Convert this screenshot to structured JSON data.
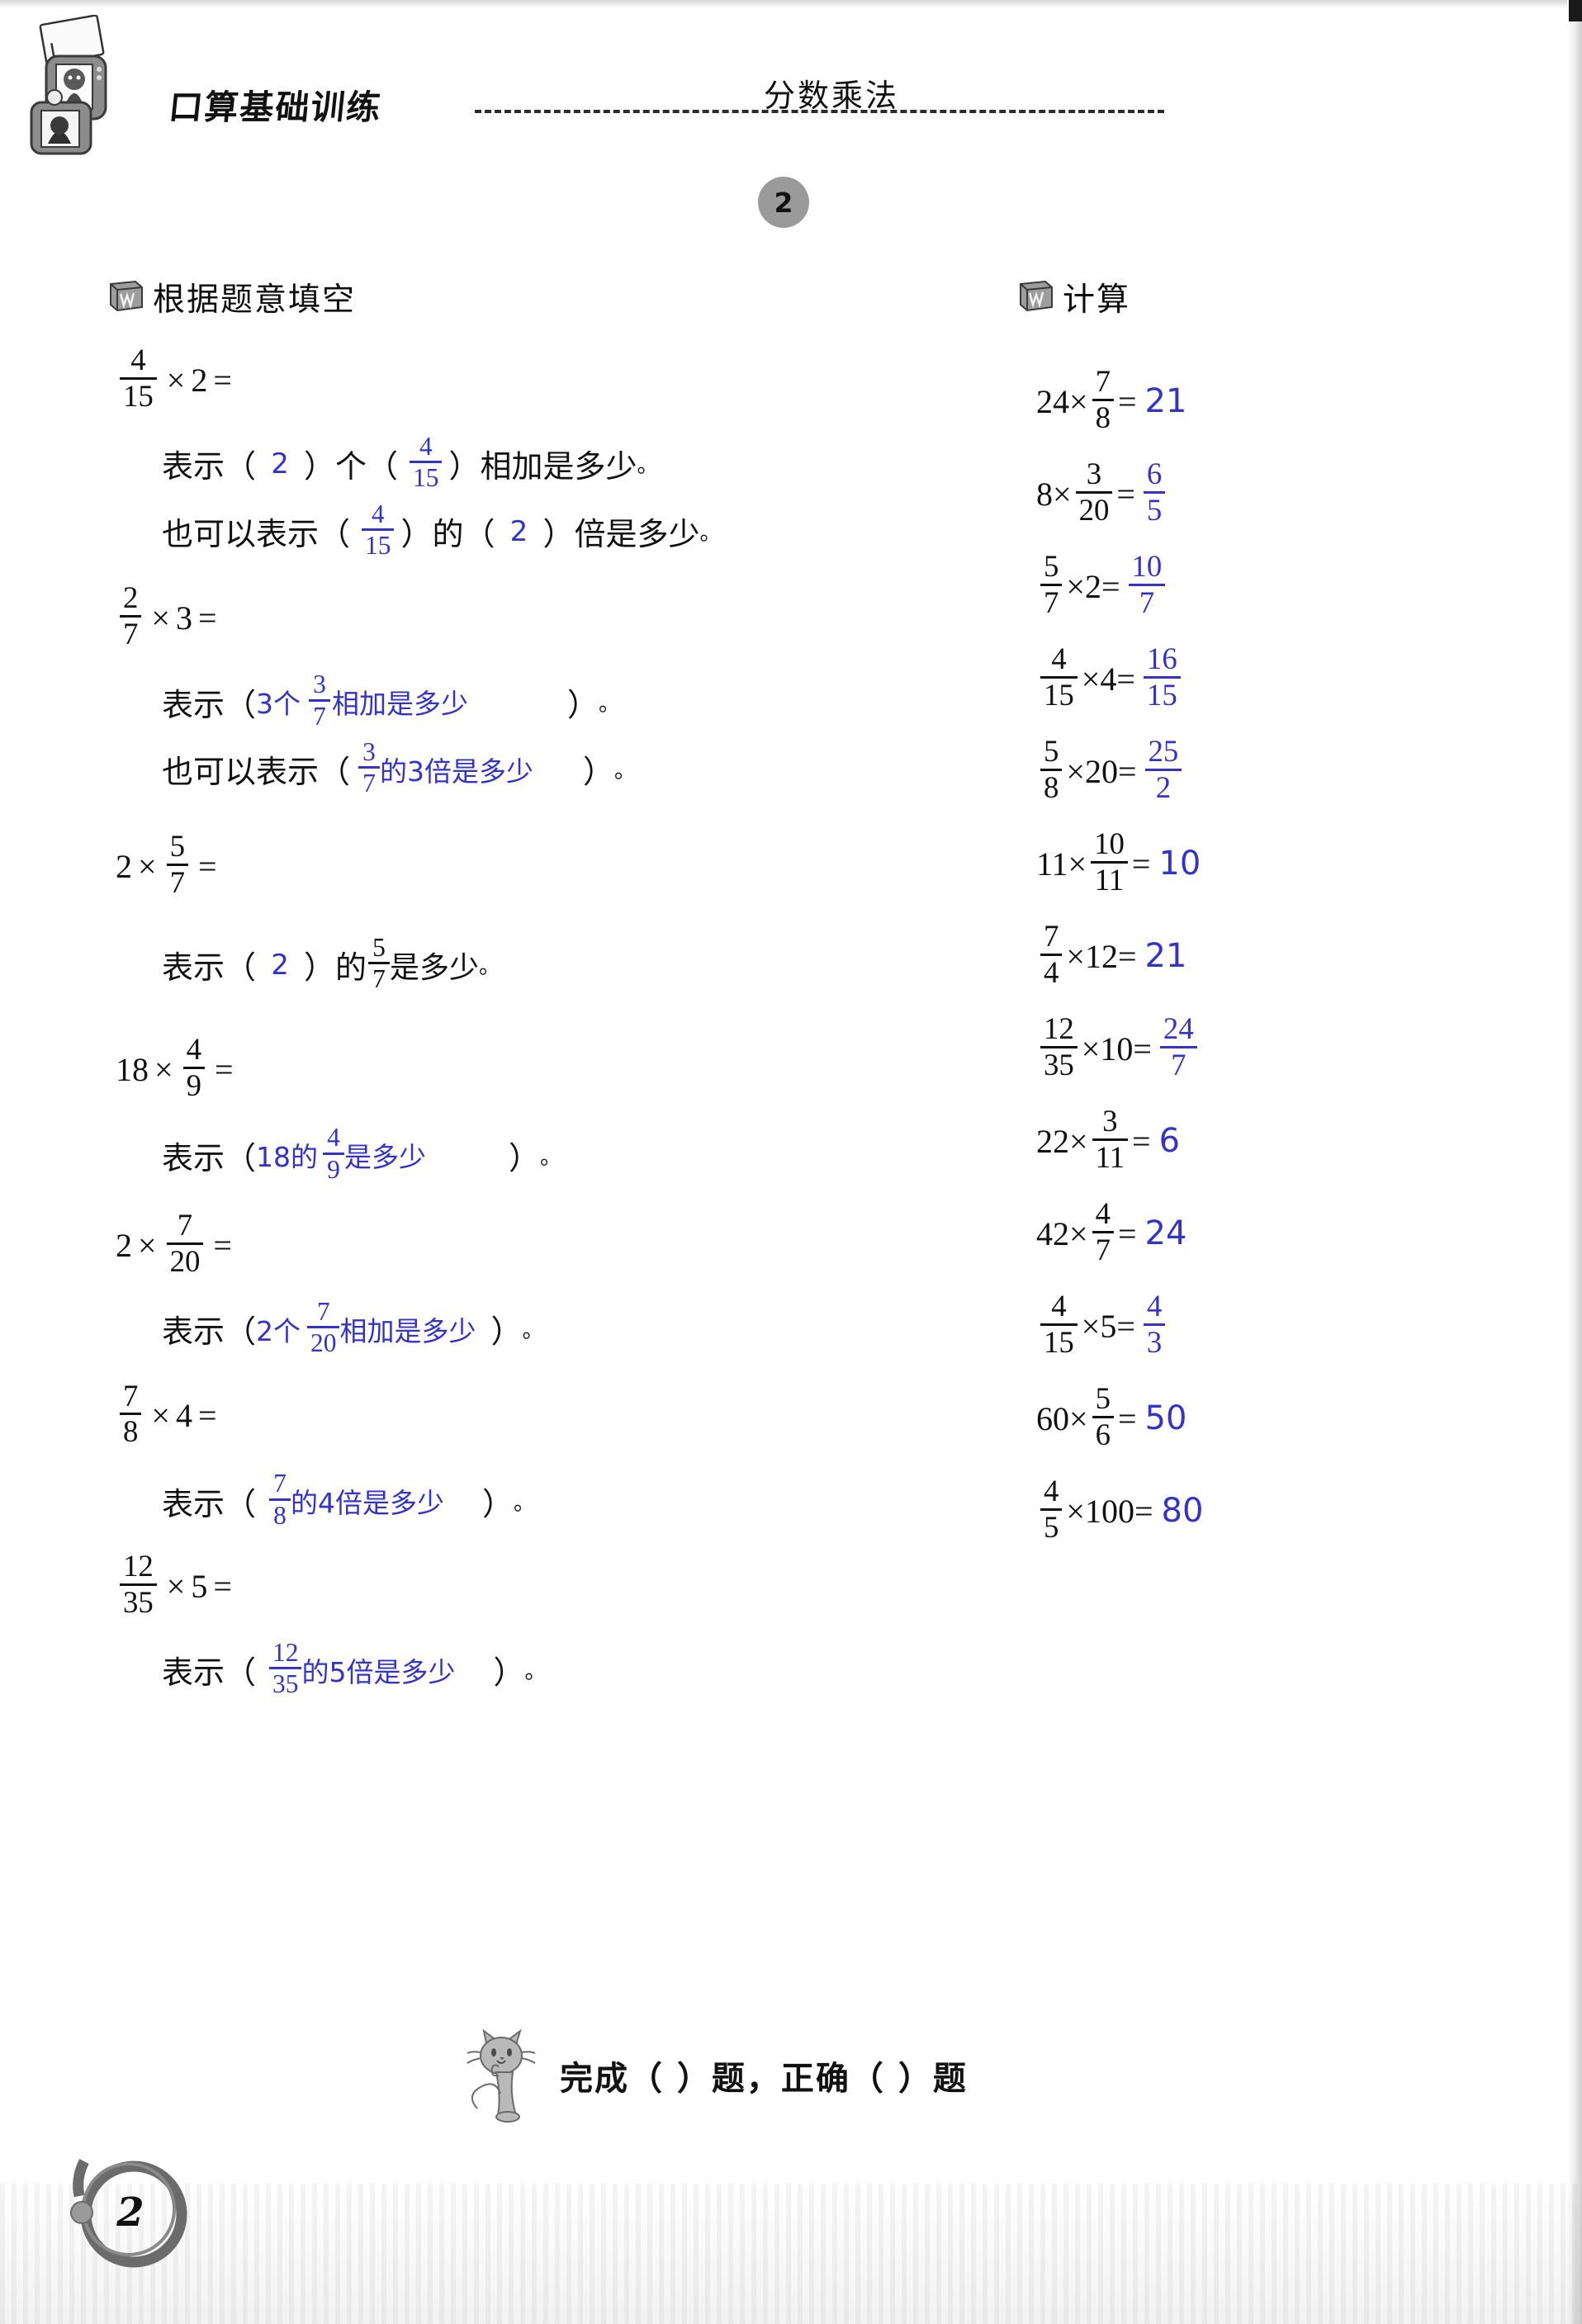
{
  "header": {
    "brand_title": "口算基础训练",
    "unit_title": "分数乘法",
    "lesson_number": "2"
  },
  "sections": {
    "left_heading": "根据题意填空",
    "right_heading": "计算"
  },
  "fill_in_problems": [
    {
      "stem": {
        "a_num": "4",
        "a_den": "15",
        "op": "×",
        "b": "2",
        "eq": "="
      },
      "lines": [
        {
          "prefix": "表示（",
          "a_value": "2",
          "mid": "）个（",
          "frac_num": "4",
          "frac_den": "15",
          "suffix": "）相加是多少",
          "period": "。"
        },
        {
          "prefix": "也可以表示（",
          "frac_num": "4",
          "frac_den": "15",
          "mid": "）的（",
          "a_value": "2",
          "suffix": "）倍是多少",
          "period": "。"
        }
      ]
    },
    {
      "stem": {
        "a_num": "2",
        "a_den": "7",
        "op": "×",
        "b": "3",
        "eq": "="
      },
      "lines": [
        {
          "prefix": "表示（",
          "answer_lead": "3个",
          "frac_num": "3",
          "frac_den": "7",
          "answer_tail": "相加是多少",
          "suffix": "）",
          "period": "。"
        },
        {
          "prefix": "也可以表示（",
          "frac_num": "3",
          "frac_den": "7",
          "answer_tail": "的3倍是多少",
          "suffix": "）",
          "period": "。"
        }
      ]
    },
    {
      "stem": {
        "a": "2",
        "op": "×",
        "b_num": "5",
        "b_den": "7",
        "eq": "="
      },
      "lines": [
        {
          "prefix": "表示（",
          "a_value": "2",
          "mid": "）的",
          "frac_num": "5",
          "frac_den": "7",
          "suffix": "是多少",
          "period": "。"
        }
      ]
    },
    {
      "stem": {
        "a": "18",
        "op": "×",
        "b_num": "4",
        "b_den": "9",
        "eq": "="
      },
      "lines": [
        {
          "prefix": "表示（",
          "answer_lead": "18的",
          "frac_num": "4",
          "frac_den": "9",
          "answer_tail": "是多少",
          "suffix": "）",
          "period": "。"
        }
      ]
    },
    {
      "stem": {
        "a": "2",
        "op": "×",
        "b_num": "7",
        "b_den": "20",
        "eq": "="
      },
      "lines": [
        {
          "prefix": "表示（",
          "answer_lead": "2个",
          "frac_num": "7",
          "frac_den": "20",
          "answer_tail": "相加是多少",
          "suffix": "）",
          "period": "。"
        }
      ]
    },
    {
      "stem": {
        "a_num": "7",
        "a_den": "8",
        "op": "×",
        "b": "4",
        "eq": "="
      },
      "lines": [
        {
          "prefix": "表示（",
          "frac_num": "7",
          "frac_den": "8",
          "answer_tail": "的4倍是多少",
          "suffix": "）",
          "period": "。"
        }
      ]
    },
    {
      "stem": {
        "a_num": "12",
        "a_den": "35",
        "op": "×",
        "b": "5",
        "eq": "="
      },
      "lines": [
        {
          "prefix": "表示（",
          "frac_num": "12",
          "frac_den": "35",
          "answer_tail": "的5倍是多少",
          "suffix": "）",
          "period": "。"
        }
      ]
    }
  ],
  "calculations": [
    {
      "left": "24",
      "frac_num": "7",
      "frac_den": "8",
      "frac_side": "right",
      "eq": "=",
      "result": "21"
    },
    {
      "left": "8",
      "frac_num": "3",
      "frac_den": "20",
      "frac_side": "right",
      "eq": "=",
      "result_num": "6",
      "result_den": "5"
    },
    {
      "left": "2",
      "frac_num": "5",
      "frac_den": "7",
      "frac_side": "left",
      "eq": "=",
      "result_num": "10",
      "result_den": "7"
    },
    {
      "left": "4",
      "frac_num": "4",
      "frac_den": "15",
      "frac_side": "left",
      "eq": "=",
      "result_num": "16",
      "result_den": "15"
    },
    {
      "left": "20",
      "frac_num": "5",
      "frac_den": "8",
      "frac_side": "left",
      "eq": "=",
      "result_num": "25",
      "result_den": "2"
    },
    {
      "left": "11",
      "frac_num": "10",
      "frac_den": "11",
      "frac_side": "right",
      "eq": "=",
      "result": "10"
    },
    {
      "left": "12",
      "frac_num": "7",
      "frac_den": "4",
      "frac_side": "left",
      "eq": "=",
      "result": "21"
    },
    {
      "left": "10",
      "frac_num": "12",
      "frac_den": "35",
      "frac_side": "left",
      "eq": "=",
      "result_num": "24",
      "result_den": "7"
    },
    {
      "left": "22",
      "frac_num": "3",
      "frac_den": "11",
      "frac_side": "right",
      "eq": "=",
      "result": "6"
    },
    {
      "left": "42",
      "frac_num": "4",
      "frac_den": "7",
      "frac_side": "right",
      "eq": "=",
      "result": "24"
    },
    {
      "left": "5",
      "frac_num": "4",
      "frac_den": "15",
      "frac_side": "left",
      "eq": "=",
      "result_num": "4",
      "result_den": "3"
    },
    {
      "left": "60",
      "frac_num": "5",
      "frac_den": "6",
      "frac_side": "right",
      "eq": "=",
      "result": "50"
    },
    {
      "left": "100",
      "frac_num": "4",
      "frac_den": "5",
      "frac_side": "left",
      "eq": "=",
      "result": "80"
    }
  ],
  "multiply_sign": "×",
  "footer": {
    "text": "完成（      ）题，正确（      ）题",
    "page_number": "2"
  },
  "colors": {
    "answer_blue": "#3333cc",
    "ink_black": "#111111",
    "badge_gray": "#9a9a9a"
  },
  "icons": {
    "mascot": "camera-kid-icon",
    "section": "book-icon",
    "footer_mascot": "cat-icon"
  }
}
